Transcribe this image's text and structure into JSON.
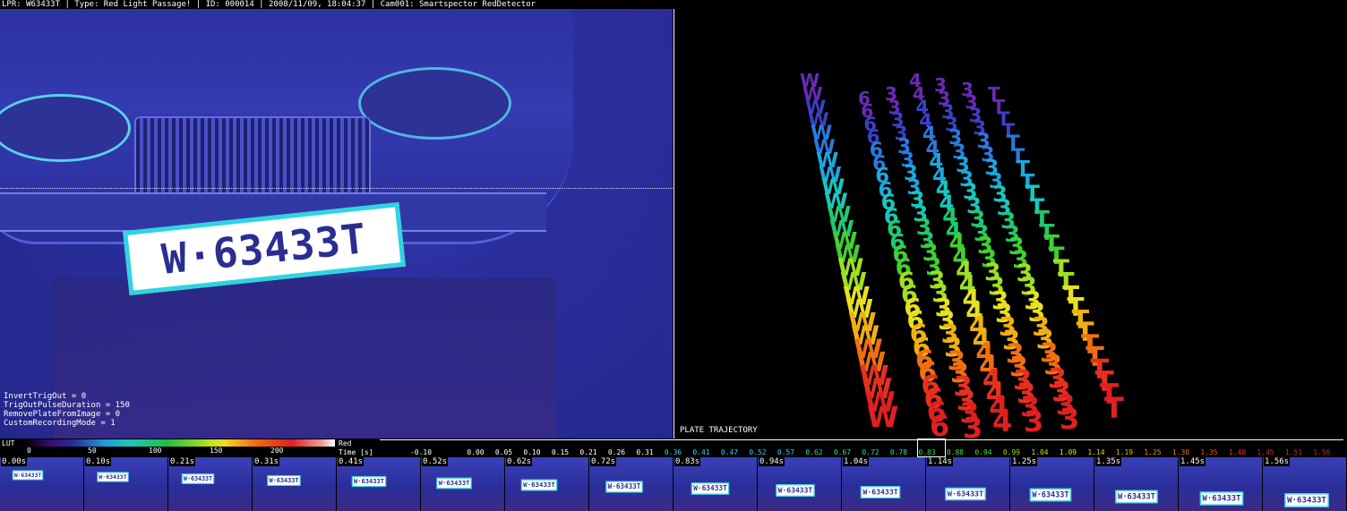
{
  "header": {
    "title": "LPR: W63433T | Type: Red Light Passage! | ID: 000014 | 2008/11/09, 18:04:37 | Cam001: Smartspector RedDetector"
  },
  "plate": {
    "text": "W·63433T"
  },
  "params": [
    "InvertTrigOut = 0",
    "TrigOutPulseDuration = 150",
    "RemovePlateFromImage = 0",
    "CustomRecordingMode = 1"
  ],
  "trajectory": {
    "label": "PLATE TRAJECTORY",
    "chars": [
      "W",
      "6",
      "3",
      "4",
      "3",
      "3",
      "T"
    ]
  },
  "lut": {
    "label": "LUT",
    "ticks": [
      "0",
      "50",
      "100",
      "150",
      "200"
    ]
  },
  "timeline": {
    "red_label": "Red",
    "time_label": "Time [s]",
    "start": "-0.10",
    "values": [
      "0.00",
      "0.05",
      "0.10",
      "0.15",
      "0.21",
      "0.26",
      "0.31",
      "0.36",
      "0.41",
      "0.47",
      "0.52",
      "0.57",
      "0.62",
      "0.67",
      "0.72",
      "0.78",
      "0.83",
      "0.88",
      "0.94",
      "0.99",
      "1.04",
      "1.09",
      "1.14",
      "1.19",
      "1.25",
      "1.30",
      "1.35",
      "1.40",
      "1.45",
      "1.51",
      "1.56"
    ],
    "colors": [
      "#ffffff",
      "#ffffff",
      "#ffffff",
      "#ffffff",
      "#ffffff",
      "#ffffff",
      "#ffffff",
      "#2ad0ff",
      "#2ad0ff",
      "#2ad0ff",
      "#2ad0ff",
      "#2ad0ff",
      "#20e0a0",
      "#20e0a0",
      "#20e0a0",
      "#20e0a0",
      "#20e060",
      "#40e040",
      "#40e040",
      "#80e020",
      "#c0e020",
      "#e0e020",
      "#f0d010",
      "#f0b010",
      "#f09010",
      "#f07010",
      "#f05010",
      "#f03020",
      "#e02020",
      "#e02020",
      "#e02020"
    ]
  },
  "thumbnails": [
    "0.00s",
    "0.10s",
    "0.21s",
    "0.31s",
    "0.41s",
    "0.52s",
    "0.62s",
    "0.72s",
    "0.83s",
    "0.94s",
    "1.04s",
    "1.14s",
    "1.25s",
    "1.35s",
    "1.45s",
    "1.56s"
  ],
  "thumb_plate_text": "W·63433T"
}
